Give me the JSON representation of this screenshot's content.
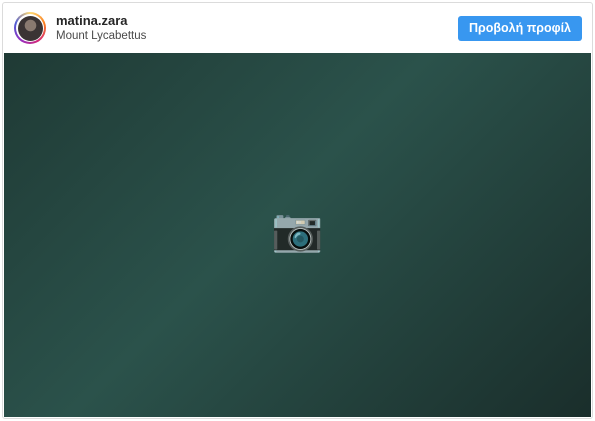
{
  "post": {
    "username": "matina.zara",
    "location": "Mount Lycabettus",
    "view_profile_label": "Προβολή προφίλ"
  },
  "media": {
    "icon": "image-icon"
  },
  "colors": {
    "button": "#3897f0",
    "border": "#dbdbdb"
  }
}
